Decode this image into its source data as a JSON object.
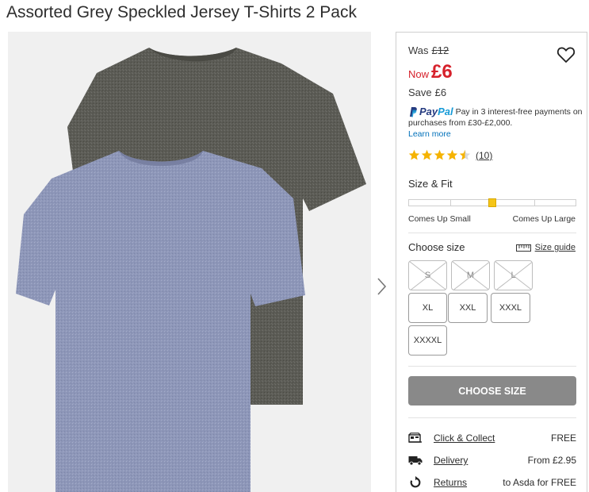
{
  "title": "Assorted Grey Speckled Jersey T-Shirts 2 Pack",
  "price": {
    "was_label": "Was",
    "was_value": "£12",
    "now_label": "Now",
    "now_value": "£6",
    "save_label": "Save",
    "save_value": "£6"
  },
  "paypal": {
    "brand_pay": "Pay",
    "brand_pal": "Pal",
    "text": "Pay in 3 interest-free payments on purchases from £30-£2,000.",
    "learn_more": "Learn more"
  },
  "rating": {
    "stars": 4.5,
    "count": "(10)"
  },
  "size_fit": {
    "label": "Size & Fit",
    "left_label": "Comes Up Small",
    "right_label": "Comes Up Large",
    "position_fraction": 0.5
  },
  "size_select": {
    "label": "Choose size",
    "guide_label": "Size guide",
    "sizes": [
      {
        "label": "S",
        "available": false
      },
      {
        "label": "M",
        "available": false
      },
      {
        "label": "L",
        "available": false
      },
      {
        "label": "XL",
        "available": true
      },
      {
        "label": "XXL",
        "available": true
      },
      {
        "label": "XXXL",
        "available": true
      },
      {
        "label": "XXXXL",
        "available": true
      }
    ]
  },
  "cta": {
    "label": "CHOOSE SIZE"
  },
  "services": [
    {
      "icon": "store-icon",
      "link": "Click & Collect",
      "value": "FREE"
    },
    {
      "icon": "truck-icon",
      "link": "Delivery",
      "value": "From £2.95"
    },
    {
      "icon": "returns-icon",
      "link": "Returns",
      "value": "to Asda for FREE"
    }
  ],
  "colors": {
    "price_red": "#d6212b",
    "star_gold": "#f5b301",
    "cta_grey": "#898989",
    "paypal_blue": "#253b80",
    "paypal_light": "#179bd7"
  }
}
